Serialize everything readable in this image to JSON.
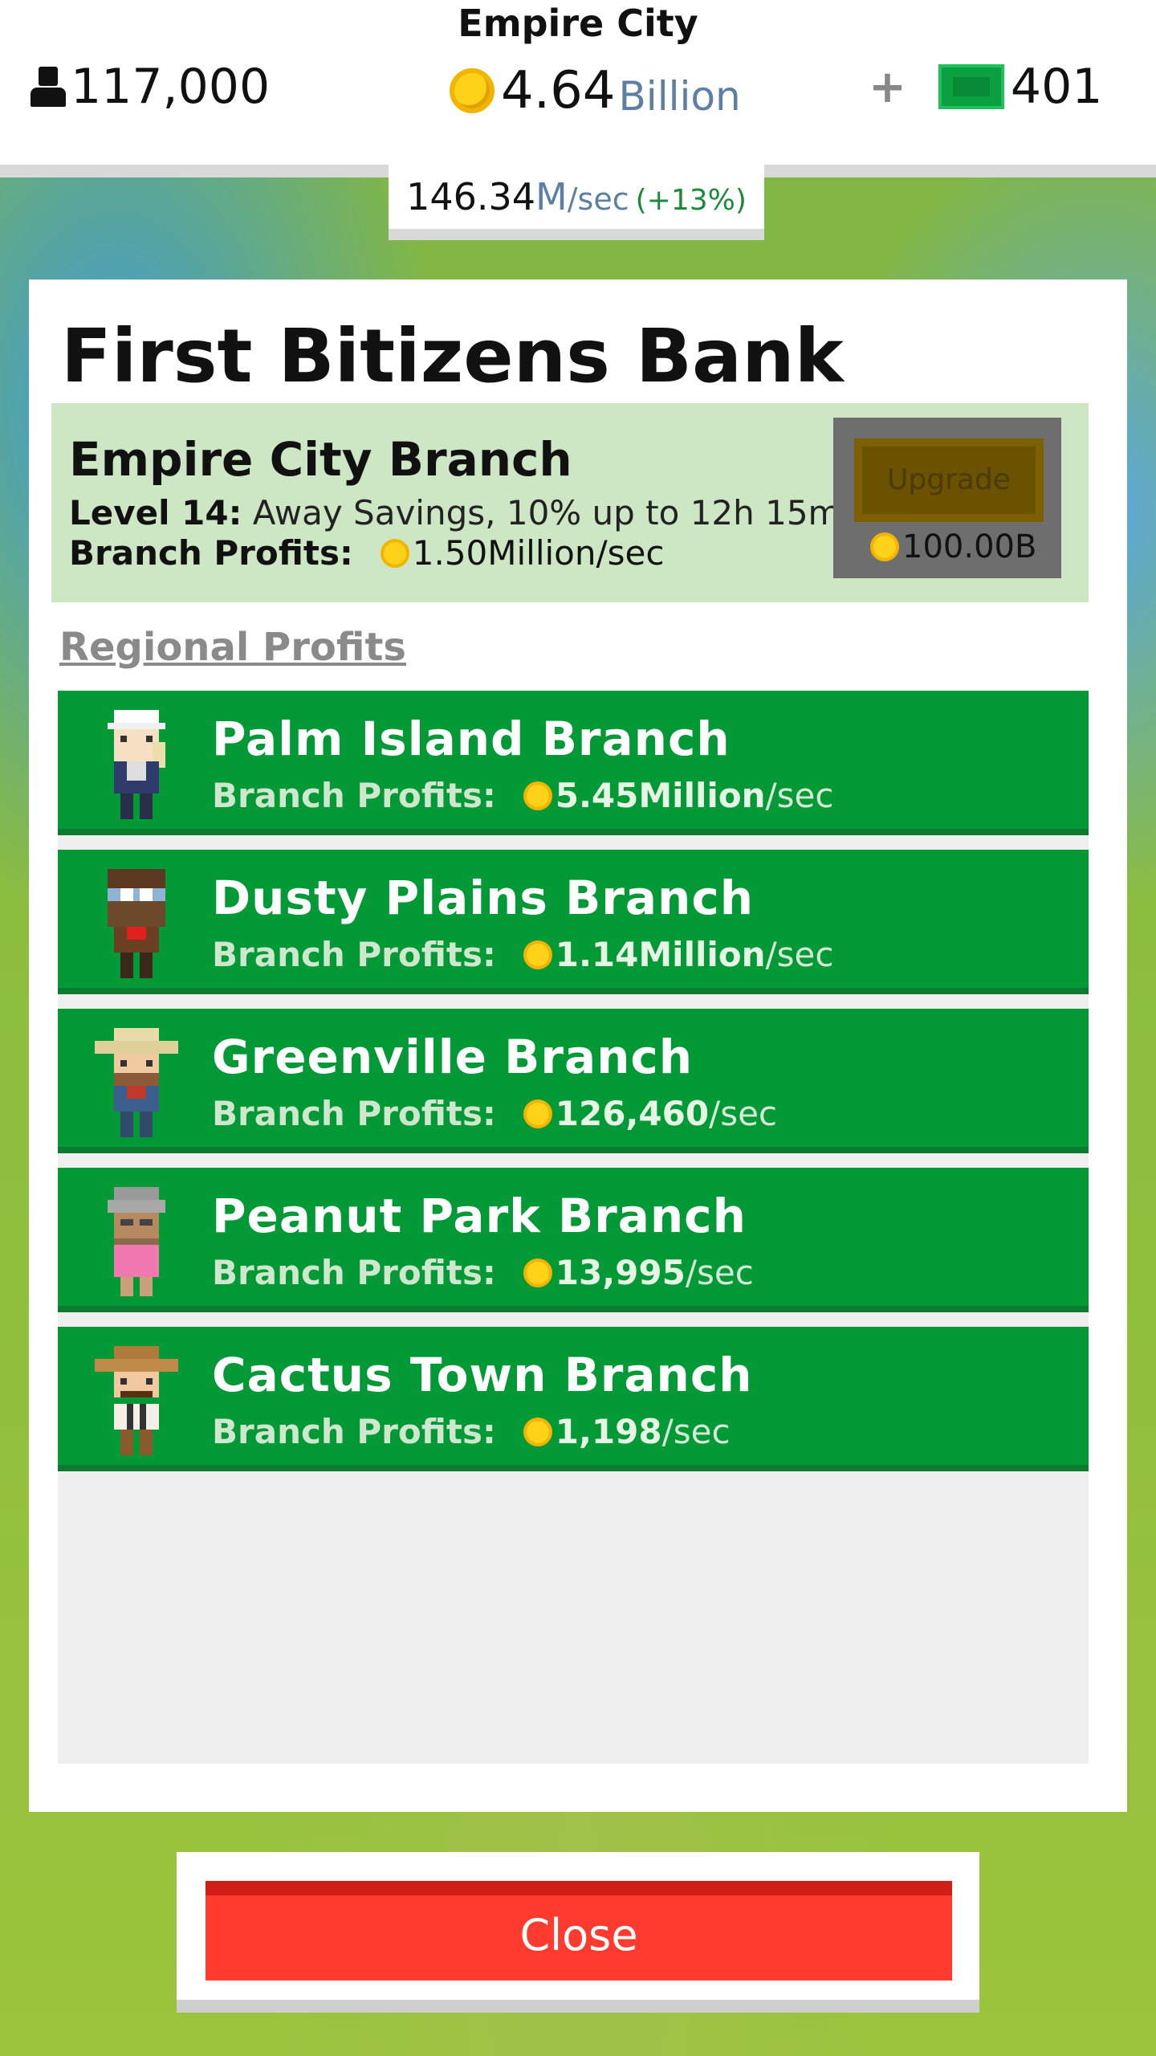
{
  "header": {
    "city": "Empire City",
    "population": "117,000",
    "money_value": "4.64",
    "money_unit": "Billion",
    "plus_label": "+",
    "bux": "401",
    "rate_value": "146.34",
    "rate_unit": "M",
    "rate_suffix": "/sec",
    "rate_bonus": "(+13%)"
  },
  "panel": {
    "title": "First Bitizens Bank",
    "branch": {
      "name": "Empire City Branch",
      "level_label": "Level 14:",
      "level_desc": "Away Savings, 10% up to 12h 15m",
      "profit_label": "Branch Profits:",
      "profit_value": "1.50Million/sec"
    },
    "upgrade": {
      "label": "Upgrade",
      "cost": "100.00B"
    },
    "regional_title": "Regional Profits",
    "branches": [
      {
        "name": "Palm Island Branch",
        "label": "Branch Profits:",
        "value": "5.45Million",
        "unit": "/sec"
      },
      {
        "name": "Dusty Plains Branch",
        "label": "Branch Profits:",
        "value": "1.14Million",
        "unit": "/sec"
      },
      {
        "name": "Greenville Branch",
        "label": "Branch Profits:",
        "value": "126,460",
        "unit": "/sec"
      },
      {
        "name": "Peanut Park Branch",
        "label": "Branch Profits:",
        "value": "13,995",
        "unit": "/sec"
      },
      {
        "name": "Cactus Town Branch",
        "label": "Branch Profits:",
        "value": "1,198",
        "unit": "/sec"
      }
    ]
  },
  "close_label": "Close",
  "colors": {
    "list_green": "#039936",
    "close_red": "#ff3b2f",
    "branch_box": "#cde6c4"
  }
}
